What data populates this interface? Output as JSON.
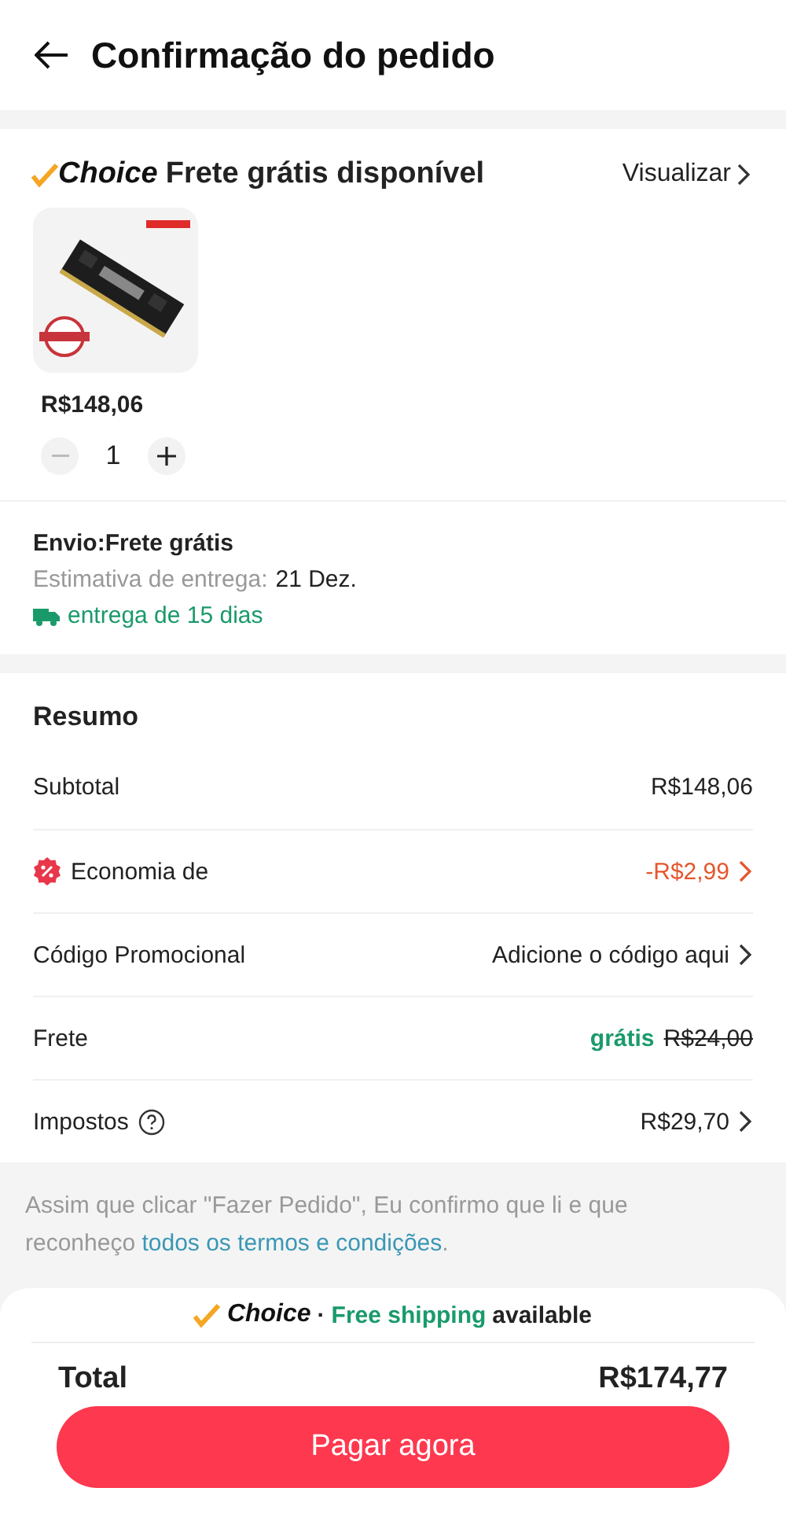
{
  "header": {
    "title": "Confirmação do pedido"
  },
  "store": {
    "brand": "Choice",
    "banner": "Frete grátis disponível",
    "link": "Visualizar"
  },
  "product": {
    "kind": "picture",
    "price": "R$148,06",
    "quantity": "1",
    "minus_disabled": true
  },
  "shipping": {
    "title": "Envio:Frete grátis",
    "estimate_label": "Estimativa de entrega:",
    "estimate_date": "21 Dez.",
    "delivery": "entrega de 15 dias"
  },
  "summary": {
    "title": "Resumo",
    "rows": [
      {
        "kind": "plain",
        "label": "Subtotal",
        "value": "R$148,06",
        "help": false,
        "has_arrow": false
      },
      {
        "kind": "discount",
        "label": "Economia de",
        "value": "-R$2,99",
        "help": false,
        "has_arrow": true
      },
      {
        "kind": "plain",
        "label": "Código Promocional",
        "value": "Adicione o código aqui",
        "help": false,
        "has_arrow": true
      },
      {
        "kind": "shipping",
        "label": "Frete",
        "value": "grátis",
        "old_value": "R$24,00",
        "help": false,
        "has_arrow": false
      },
      {
        "kind": "plain",
        "label": "Impostos",
        "value": "R$29,70",
        "help": true,
        "has_arrow": true
      }
    ]
  },
  "terms": {
    "text": "Assim que clicar \"Fazer Pedido\", Eu confirmo que li e que reconheço ",
    "link": "todos os termos e condições",
    "end": "."
  },
  "footer": {
    "brand": "Choice",
    "separator": "·",
    "highlight": "Free shipping",
    "rest": "available",
    "total_label": "Total",
    "total": "R$174,77",
    "button": "Pagar agora"
  }
}
